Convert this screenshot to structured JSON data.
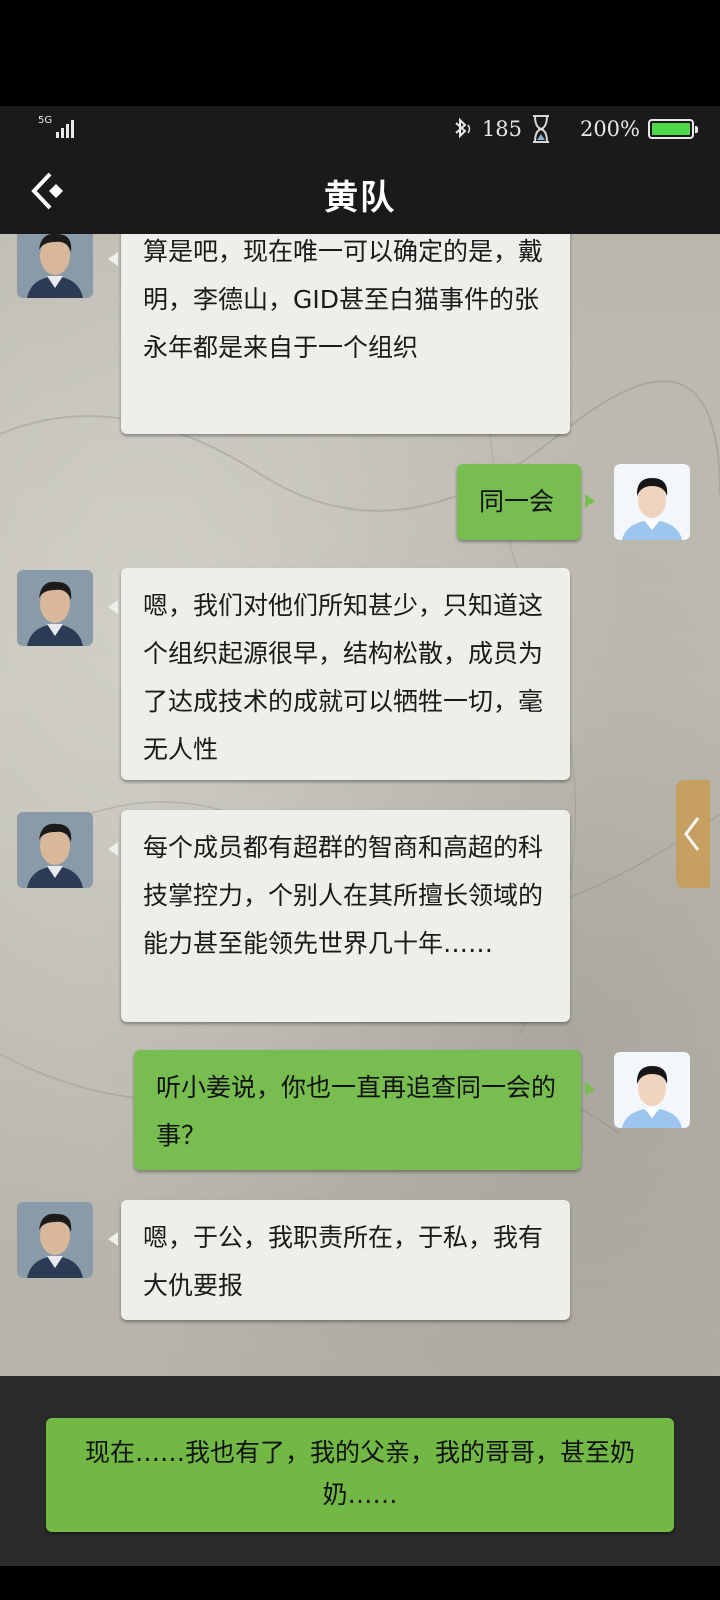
{
  "status": {
    "network": "5G",
    "counter": "185",
    "battery": "200%",
    "battery_color": "#4fd84a"
  },
  "header": {
    "title": "黄队"
  },
  "messages": [
    {
      "side": "in",
      "text": "算是吧，现在唯一可以确定的是，戴明，李德山，GID甚至白猫事件的张永年都是来自于一个组织"
    },
    {
      "side": "out",
      "text": "同一会"
    },
    {
      "side": "in",
      "text": "嗯，我们对他们所知甚少，只知道这个组织起源很早，结构松散，成员为了达成技术的成就可以牺牲一切，毫无人性"
    },
    {
      "side": "in",
      "text": "每个成员都有超群的智商和高超的科技掌控力，个别人在其所擅长领域的能力甚至能领先世界几十年……"
    },
    {
      "side": "out",
      "text": "听小姜说，你也一直再追查同一会的事？"
    },
    {
      "side": "in",
      "text": "嗯，于公，我职责所在，于私，我有大仇要报"
    }
  ],
  "reply_option": "现在……我也有了，我的父亲，我的哥哥，甚至奶奶……",
  "colors": {
    "incoming_bubble": "#efefea",
    "outgoing_bubble": "#78bd4f",
    "header": "#1a1a1a"
  }
}
